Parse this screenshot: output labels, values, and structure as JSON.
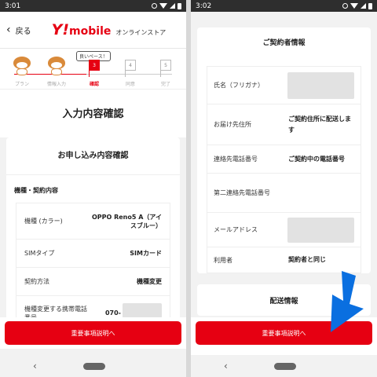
{
  "left": {
    "status_time": "3:01",
    "header": {
      "back_label": "戻る",
      "logo_y": "Y!",
      "logo_mobile": "mobile",
      "store_label": "オンラインストア"
    },
    "stepper": {
      "bubble": "良いペース！",
      "steps": [
        {
          "num": "",
          "label": "プラン"
        },
        {
          "num": "",
          "label": "情報入力"
        },
        {
          "num": "3",
          "label": "確認"
        },
        {
          "num": "4",
          "label": "同意"
        },
        {
          "num": "5",
          "label": "完了"
        }
      ]
    },
    "page_title": "入力内容確認",
    "card_title": "お申し込み内容確認",
    "section_label": "機種・契約内容",
    "rows": [
      {
        "key": "機種 (カラー)",
        "value": "OPPO Reno5 A（アイスブルー）"
      },
      {
        "key": "SIMタイプ",
        "value": "SIMカード"
      },
      {
        "key": "契約方法",
        "value": "機種変更"
      },
      {
        "key": "機種変更する携帯電話番号",
        "value": "070-"
      }
    ],
    "button_label": "重要事項説明へ"
  },
  "right": {
    "status_time": "3:02",
    "card_title": "ご契約者情報",
    "rows": [
      {
        "key": "氏名（フリガナ）",
        "value": ""
      },
      {
        "key": "お届け先住所",
        "value": "ご契約住所に配送します"
      },
      {
        "key": "連絡先電話番号",
        "value": "ご契約中の電話番号"
      },
      {
        "key": "第二連絡先電話番号",
        "value": ""
      },
      {
        "key": "メールアドレス",
        "value": ""
      },
      {
        "key": "利用者",
        "value": "契約者と同じ"
      }
    ],
    "next_card_title": "配送情報",
    "button_label": "重要事項説明へ"
  },
  "colors": {
    "accent": "#e60012",
    "arrow": "#0a6fe0"
  },
  "icons": [
    "chevron-left-icon",
    "gear-icon",
    "wifi-icon",
    "signal-icon",
    "battery-icon",
    "nav-back-icon",
    "nav-home-pill",
    "blue-arrow-icon"
  ]
}
